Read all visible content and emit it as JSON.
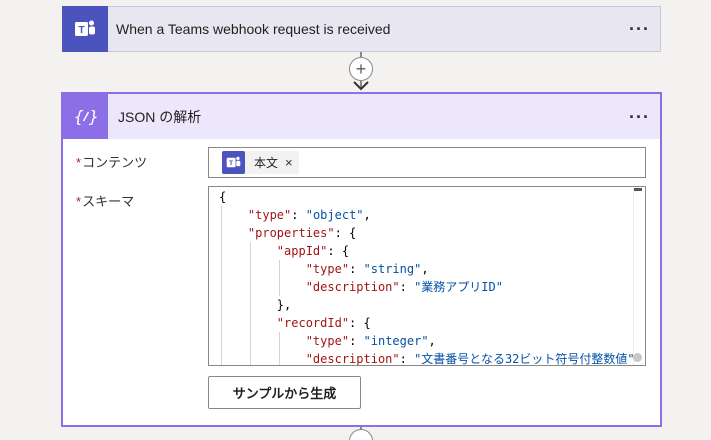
{
  "trigger": {
    "title": "When a Teams webhook request is received",
    "icon": "teams-icon",
    "more": "···"
  },
  "connector": {
    "add_symbol": "+"
  },
  "action": {
    "title": "JSON の解析",
    "icon": "json-braces-icon",
    "icon_text": "{⁄}",
    "more": "···",
    "accent_color": "#8c6fe6",
    "fields": {
      "content": {
        "label": "コンテンツ",
        "required_mark": "*",
        "token_label": "本文",
        "token_close": "×"
      },
      "schema": {
        "label": "スキーマ",
        "required_mark": "*"
      }
    },
    "sample_button": "サンプルから生成"
  },
  "schema_code": {
    "l1": "{",
    "l2_key": "\"type\"",
    "l2_val": "\"object\"",
    "l3_key": "\"properties\"",
    "l4_key": "\"appId\"",
    "l5_key": "\"type\"",
    "l5_val": "\"string\"",
    "l6_key": "\"description\"",
    "l6_val": "\"業務アプリID\"",
    "l7": "},",
    "l8_key": "\"recordId\"",
    "l9_key": "\"type\"",
    "l9_val": "\"integer\"",
    "l10_key": "\"description\"",
    "l10_val": "\"文書番号となる32ビット符号付整数値\""
  }
}
